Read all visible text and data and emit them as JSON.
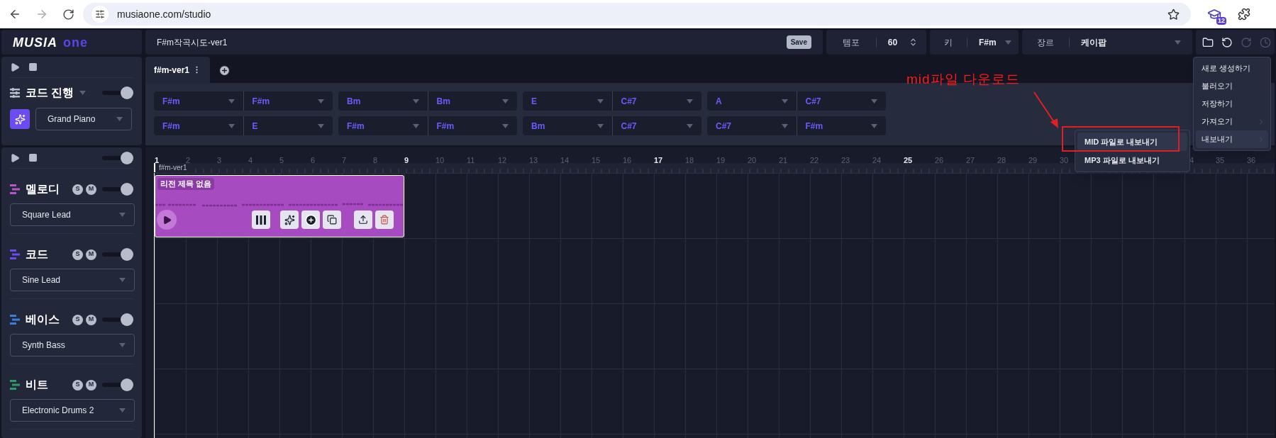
{
  "browser": {
    "url": "musiaone.com/studio",
    "extension_badge": "12"
  },
  "logo": {
    "text": "MUSIA",
    "accent": "one"
  },
  "project": {
    "title": "F#m작곡시도-ver1",
    "save": "Save"
  },
  "tempo": {
    "label": "템포",
    "value": "60"
  },
  "key": {
    "label": "키",
    "value": "F#m"
  },
  "genre": {
    "label": "장르",
    "value": "케이팝"
  },
  "toolbar": [
    {
      "kind": "folder",
      "disabled": false
    },
    {
      "kind": "undo",
      "disabled": false
    },
    {
      "kind": "redo",
      "disabled": true
    },
    {
      "kind": "history",
      "disabled": true
    }
  ],
  "master": {
    "level": 1
  },
  "chord_panel": {
    "title": "코드 진행",
    "level": 1,
    "instrument": "Grand Piano"
  },
  "tabs": [
    {
      "label": "f#m-ver1",
      "selected": true
    }
  ],
  "chord_rows": [
    [
      [
        "F#m",
        "F#m"
      ],
      [
        "Bm",
        "Bm"
      ],
      [
        "E",
        "C#7"
      ],
      [
        "A",
        "C#7"
      ]
    ],
    [
      [
        "F#m",
        "E"
      ],
      [
        "F#m",
        "F#m"
      ],
      [
        "Bm",
        "C#7"
      ],
      [
        "C#7",
        "F#m"
      ]
    ]
  ],
  "ruler": {
    "start": [
      "1",
      "2",
      "3",
      "4",
      "5",
      "6",
      "7",
      "8",
      "9",
      "10",
      "11",
      "12",
      "13",
      "14",
      "15",
      "16",
      "17",
      "18",
      "19",
      "20",
      "21",
      "22",
      "23",
      "24",
      "25",
      "26",
      "27",
      "28",
      "29",
      "30"
    ],
    "end": [
      "4",
      "35",
      "36"
    ]
  },
  "marker": "f#m-ver1",
  "tracks": [
    {
      "name": "멜로디",
      "color": "#b656c9",
      "solo": "S",
      "mute": "M",
      "level": 1,
      "instrument": "Square Lead"
    },
    {
      "name": "코드",
      "color": "#6a4cf0",
      "solo": "S",
      "mute": "M",
      "level": 1,
      "instrument": "Sine Lead"
    },
    {
      "name": "베이스",
      "color": "#3a7fd6",
      "solo": "S",
      "mute": "M",
      "level": 1,
      "instrument": "Synth Bass"
    },
    {
      "name": "비트",
      "color": "#2f9a6a",
      "solo": "S",
      "mute": "M",
      "level": 1,
      "instrument": "Electronic Drums 2"
    }
  ],
  "region": {
    "title": "리전 제목 없음"
  },
  "menu": {
    "items": [
      {
        "label": "새로 생성하기",
        "has_submenu": false,
        "selected": false
      },
      {
        "label": "불러오기",
        "has_submenu": false,
        "selected": false
      },
      {
        "label": "저장하기",
        "has_submenu": false,
        "selected": false
      },
      {
        "label": "가져오기",
        "has_submenu": true,
        "selected": false
      },
      {
        "label": "내보내기",
        "has_submenu": true,
        "selected": true
      }
    ],
    "submenu": [
      {
        "label": "MID 파일로 내보내기",
        "selected": true
      },
      {
        "label": "MP3 파일로 내보내기",
        "selected": false
      }
    ]
  },
  "annotation": {
    "text": "mid파일 다운로드"
  }
}
